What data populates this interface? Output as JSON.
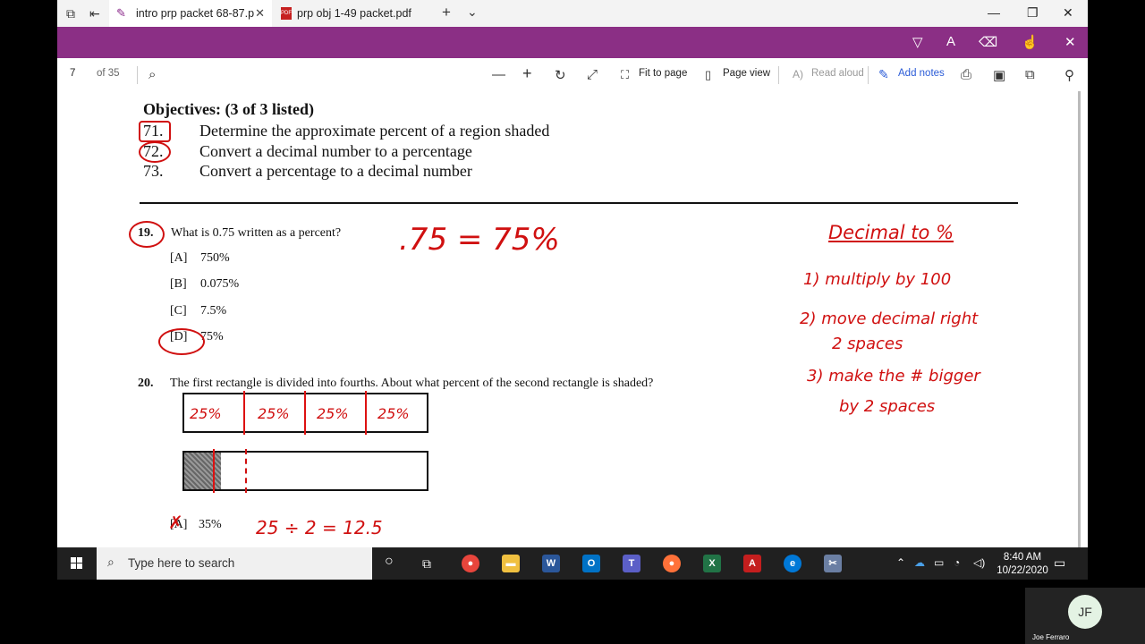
{
  "browser": {
    "tabs": [
      {
        "label": "intro prp packet 68-87.p",
        "active": true
      },
      {
        "label": "prp obj 1-49 packet.pdf",
        "active": false
      }
    ],
    "new_tab": "+",
    "tab_menu": "⌄"
  },
  "pdf_toolbar": {
    "page": "7",
    "of_pages": "of 35",
    "fit_to_page": "Fit to page",
    "page_view": "Page view",
    "read_aloud": "Read aloud",
    "add_notes": "Add notes"
  },
  "doc": {
    "objectives_heading": "Objectives: (3 of 3 listed)",
    "objectives": [
      {
        "num": "71.",
        "text": "Determine the approximate percent of a region shaded"
      },
      {
        "num": "72.",
        "text": "Convert a decimal number to a percentage"
      },
      {
        "num": "73.",
        "text": "Convert a percentage to a decimal number"
      }
    ],
    "q19": {
      "num": "19.",
      "text": "What is 0.75 written as a percent?",
      "options": [
        {
          "letter": "[A]",
          "text": "750%"
        },
        {
          "letter": "[B]",
          "text": "0.075%"
        },
        {
          "letter": "[C]",
          "text": "7.5%"
        },
        {
          "letter": "[D]",
          "text": "75%"
        }
      ]
    },
    "q20": {
      "num": "20.",
      "text": "The first rectangle is divided into fourths. About what percent of the second rectangle is shaded?",
      "options": [
        {
          "letter": "[A]",
          "text": "35%"
        }
      ]
    }
  },
  "ink": {
    "q19_work": ".75 = 75%",
    "quarters": [
      "25%",
      "25%",
      "25%",
      "25%"
    ],
    "q20_work": "25 ÷ 2 = 12.5",
    "notes_title": "Decimal to %",
    "notes": [
      "1) multiply by 100",
      "2) move decimal right",
      "2 spaces",
      "3) make the # bigger",
      "by 2 spaces"
    ],
    "color": "#d01010"
  },
  "taskbar": {
    "search_placeholder": "Type here to search",
    "time": "8:40 AM",
    "date": "10/22/2020"
  },
  "camera": {
    "initials": "JF",
    "name": "Joe Ferraro"
  }
}
